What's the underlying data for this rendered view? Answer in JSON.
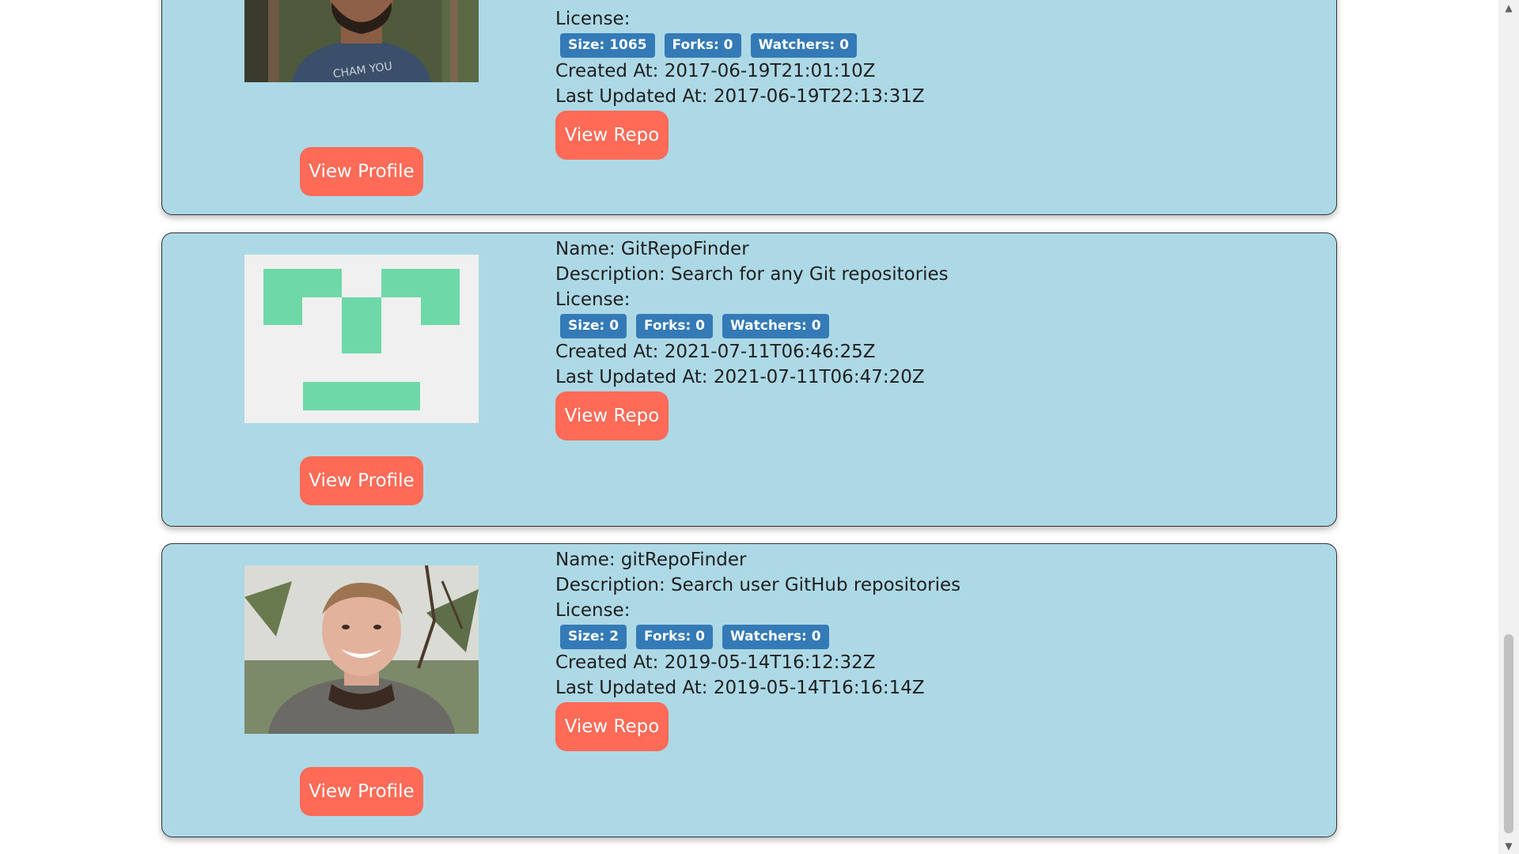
{
  "labels": {
    "name_prefix": "Name: ",
    "description_prefix": "Description: ",
    "license_prefix": "License:",
    "created_prefix": "Created At: ",
    "updated_prefix": "Last Updated At: ",
    "size_prefix": "Size: ",
    "forks_prefix": "Forks: ",
    "watchers_prefix": "Watchers: ",
    "view_repo": "View Repo",
    "view_profile": "View Profile"
  },
  "repos": [
    {
      "license": "License:",
      "size": "Size: 1065",
      "forks": "Forks: 0",
      "watchers": "Watchers: 0",
      "created": "Created At: 2017-06-19T21:01:10Z",
      "updated": "Last Updated At: 2017-06-19T22:13:31Z",
      "avatar_icon": "user-photo-bearded-man",
      "view_repo": "View Repo",
      "view_profile": "View Profile"
    },
    {
      "name": "Name: GitRepoFinder",
      "description": "Description: Search for any Git repositories",
      "license": "License:",
      "size": "Size: 0",
      "forks": "Forks: 0",
      "watchers": "Watchers: 0",
      "created": "Created At: 2021-07-11T06:46:25Z",
      "updated": "Last Updated At: 2021-07-11T06:47:20Z",
      "avatar_icon": "identicon-green",
      "view_repo": "View Repo",
      "view_profile": "View Profile"
    },
    {
      "name": "Name: gitRepoFinder",
      "description": "Description: Search user GitHub repositories",
      "license": "License:",
      "size": "Size: 2",
      "forks": "Forks: 0",
      "watchers": "Watchers: 0",
      "created": "Created At: 2019-05-14T16:12:32Z",
      "updated": "Last Updated At: 2019-05-14T16:16:14Z",
      "avatar_icon": "user-photo-smiling-man",
      "view_repo": "View Repo",
      "view_profile": "View Profile"
    }
  ],
  "colors": {
    "card_bg": "#add8e6",
    "button_bg": "#ff6b57",
    "badge_bg": "#337ab7",
    "identicon_green": "#6fd8a8"
  }
}
